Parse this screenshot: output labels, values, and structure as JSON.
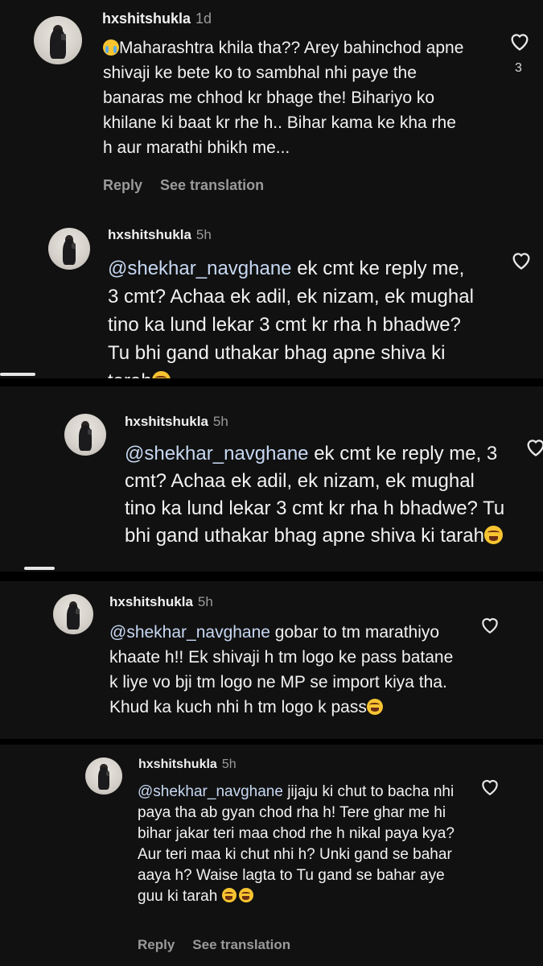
{
  "comments": [
    {
      "username": "hxshitshukla",
      "time": "1d",
      "text": "Maharashtra khila tha?? Arey bahinchod apne shivaji ke bete ko to sambhal nhi paye the banaras me chhod kr bhage the! Bihariyo ko khilane ki baat kr rhe h.. Bihar kama ke kha rhe h aur marathi bhikh me...",
      "leading_emoji": "crying-face",
      "likes": "3",
      "actions": {
        "reply": "Reply",
        "translate": "See translation"
      }
    },
    {
      "username": "hxshitshukla",
      "time": "5h",
      "mention": "@shekhar_navghane",
      "text": " ek cmt ke reply me, 3 cmt? Achaa ek adil, ek nizam, ek mughal tino ka lund lekar 3 cmt kr rha h bhadwe? Tu bhi gand uthakar bhag apne shiva ki tarah",
      "trailing_emoji": "laughing-face"
    },
    {
      "username": "hxshitshukla",
      "time": "5h",
      "mention": "@shekhar_navghane",
      "text": " ek cmt ke reply me, 3 cmt? Achaa ek adil, ek nizam, ek mughal tino ka lund lekar 3 cmt kr rha h bhadwe? Tu bhi gand uthakar bhag apne shiva ki tarah",
      "trailing_emoji": "laughing-face"
    },
    {
      "username": "hxshitshukla",
      "time": "5h",
      "mention": "@shekhar_navghane",
      "text": " gobar to tm marathiyo khaate h!! Ek shivaji h tm logo ke pass batane k liye vo bji tm logo ne MP se import kiya tha. Khud ka kuch nhi h tm logo k pass",
      "trailing_emoji": "laughing-face"
    },
    {
      "username": "hxshitshukla",
      "time": "5h",
      "mention": "@shekhar_navghane",
      "text": " jijaju ki chut to bacha nhi paya tha ab gyan chod rha h! Tere ghar me hi bihar jakar teri maa chod rhe h nikal paya kya? Aur teri maa ki chut nhi h? Unki gand se bahar aaya h? Waise lagta to Tu gand se bahar aye guu ki tarah ",
      "trailing_emoji": "laughing-face x2",
      "actions": {
        "reply": "Reply",
        "translate": "See translation"
      }
    }
  ],
  "colors": {
    "background": "#111111",
    "mention": "#c7d8f3",
    "muted": "#9a9a9a"
  }
}
